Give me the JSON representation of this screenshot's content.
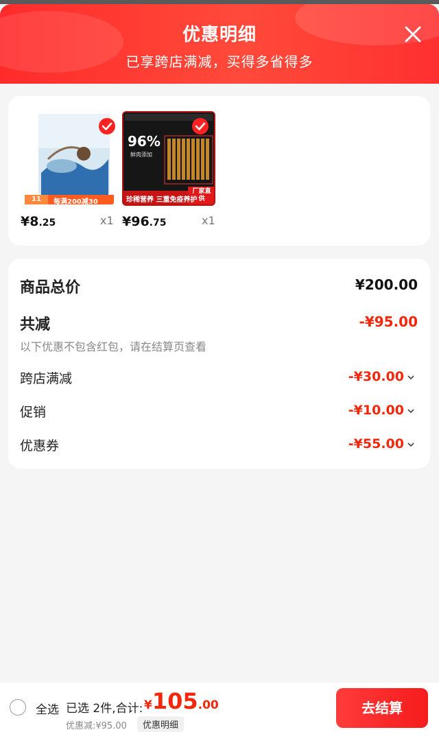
{
  "header": {
    "title": "优惠明细",
    "subtitle": "已享跨店满减，买得多省得多",
    "close_icon": "close-icon"
  },
  "products": [
    {
      "price_main": "¥8",
      "price_decimal": ".25",
      "qty": "x1",
      "selected": true,
      "badge_left": "11",
      "badge_right": "每满200减30",
      "icon": "check-icon"
    },
    {
      "price_main": "¥96",
      "price_decimal": ".75",
      "qty": "x1",
      "selected": true,
      "headline": "96%",
      "headline_sub": "鲜肉添加",
      "banner": "珍稀营养 三重免疫养护",
      "tag": "厂家直供",
      "icon": "check-icon"
    }
  ],
  "breakdown": {
    "total_label": "商品总价",
    "total_value": "¥200.00",
    "reduce_label": "共减",
    "reduce_value": "-¥95.00",
    "note": "以下优惠不包含红包，请在结算页查看",
    "items": [
      {
        "label": "跨店满减",
        "amount": "-¥30.00",
        "icon": "chevron-down-icon"
      },
      {
        "label": "促销",
        "amount": "-¥10.00",
        "icon": "chevron-down-icon"
      },
      {
        "label": "优惠券",
        "amount": "-¥55.00",
        "icon": "chevron-down-icon"
      }
    ]
  },
  "footer": {
    "select_all": "全选",
    "summary": "已选 2件,合计:",
    "total_yen": "¥",
    "total_int": "105",
    "total_dec": ".00",
    "discount": "优惠减:¥95.00",
    "detail_button": "优惠明细",
    "checkout_button": "去结算"
  },
  "colors": {
    "accent": "#f2270c",
    "header_bg": "#ff3030",
    "page_bg": "#f5f5f5"
  }
}
